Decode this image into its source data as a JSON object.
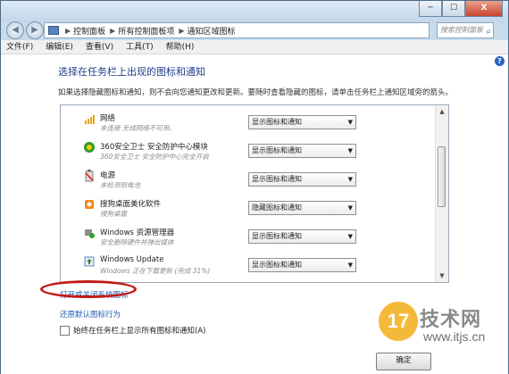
{
  "window": {
    "buttons": {
      "minimize": "─",
      "maximize": "☐",
      "close": "X"
    },
    "nav": {
      "back": "◀",
      "forward": "▶"
    },
    "address": [
      "控制面板",
      "所有控制面板项",
      "通知区域图标"
    ],
    "search_placeholder": "搜索控制面板"
  },
  "menu": [
    "文件(F)",
    "编辑(E)",
    "查看(V)",
    "工具(T)",
    "帮助(H)"
  ],
  "content": {
    "help": "?",
    "heading": "选择在任务栏上出现的图标和通知",
    "description": "如果选择隐藏图标和通知，则不会向您通知更改和更新。要随时查看隐藏的图标，请单击任务栏上通知区域旁的箭头。",
    "icons": [
      {
        "name": "网络",
        "status": "未连接 无线网络不可用。",
        "behavior": "显示图标和通知",
        "icon": "network-icon"
      },
      {
        "name": "360安全卫士 安全防护中心模块",
        "status": "360安全卫士 安全防护中心完全开启",
        "behavior": "显示图标和通知",
        "icon": "shield-360-icon"
      },
      {
        "name": "电源",
        "status": "未检测到电池",
        "behavior": "显示图标和通知",
        "icon": "power-icon"
      },
      {
        "name": "搜狗桌面美化软件",
        "status": "搜狗桌面",
        "behavior": "隐藏图标和通知",
        "icon": "sogou-icon"
      },
      {
        "name": "Windows 资源管理器",
        "status": "安全删除硬件并弹出媒体",
        "behavior": "显示图标和通知",
        "icon": "usb-icon"
      },
      {
        "name": "Windows Update",
        "status": "Windows 正在下载更新 (完成 31%)",
        "behavior": "显示图标和通知",
        "icon": "windows-update-icon"
      }
    ],
    "link_system_icons": "打开或关闭系统图标",
    "link_restore": "还原默认图标行为",
    "checkbox_label": "始终在任务栏上显示所有图标和通知(A)",
    "ok_button": "确定"
  },
  "watermark": {
    "logo": "17",
    "name": "技术网",
    "url": "www.itjs.cn"
  }
}
